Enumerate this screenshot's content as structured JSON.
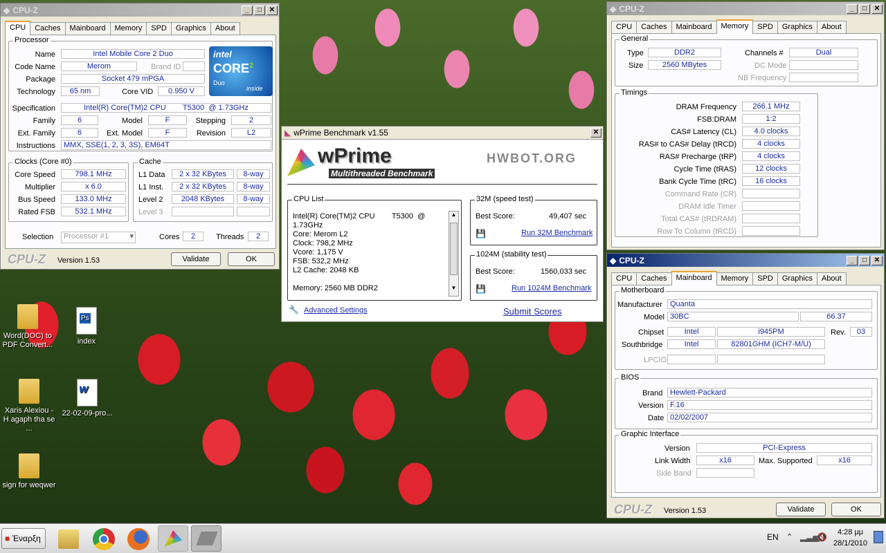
{
  "cpuz_cpu": {
    "title": "CPU-Z",
    "tabs": [
      "CPU",
      "Caches",
      "Mainboard",
      "Memory",
      "SPD",
      "Graphics",
      "About"
    ],
    "processor_label": "Processor",
    "name_label": "Name",
    "name": "Intel Mobile Core 2 Duo",
    "codename_label": "Code Name",
    "codename": "Merom",
    "brandid_label": "Brand ID",
    "package_label": "Package",
    "package": "Socket 479 mPGA",
    "technology_label": "Technology",
    "technology": "65 nm",
    "corevid_label": "Core VID",
    "corevid": "0.950 V",
    "spec_label": "Specification",
    "spec": "Intel(R) Core(TM)2 CPU        T5300  @ 1.73GHz",
    "family_label": "Family",
    "family": "6",
    "model_label": "Model",
    "model": "F",
    "stepping_label": "Stepping",
    "stepping": "2",
    "extfamily_label": "Ext. Family",
    "extfamily": "6",
    "extmodel_label": "Ext. Model",
    "extmodel": "F",
    "revision_label": "Revision",
    "revision": "L2",
    "instr_label": "Instructions",
    "instr": "MMX, SSE(1, 2, 3, 3S), EM64T",
    "clocks_label": "Clocks (Core #0)",
    "cache_label": "Cache",
    "corespeed_label": "Core Speed",
    "corespeed": "798.1 MHz",
    "multiplier_label": "Multiplier",
    "multiplier": "x 6.0",
    "busspeed_label": "Bus Speed",
    "busspeed": "133.0 MHz",
    "ratedfsb_label": "Rated FSB",
    "ratedfsb": "532.1 MHz",
    "l1d_label": "L1 Data",
    "l1d": "2 x 32 KBytes",
    "l1d_way": "8-way",
    "l1i_label": "L1 Inst.",
    "l1i": "2 x 32 KBytes",
    "l1i_way": "8-way",
    "l2_label": "Level 2",
    "l2": "2048 KBytes",
    "l2_way": "8-way",
    "l3_label": "Level 3",
    "selection_label": "Selection",
    "selection": "Processor #1",
    "cores_label": "Cores",
    "cores": "2",
    "threads_label": "Threads",
    "threads": "2",
    "version": "Version 1.53",
    "validate": "Validate",
    "ok": "OK",
    "logo_text": "CPU-Z",
    "intel_logo": {
      "brand": "intel",
      "core": "CORE",
      "sup": "2",
      "duo": "Duo",
      "inside": "inside"
    }
  },
  "cpuz_mem": {
    "title": "CPU-Z",
    "tabs": [
      "CPU",
      "Caches",
      "Mainboard",
      "Memory",
      "SPD",
      "Graphics",
      "About"
    ],
    "general_label": "General",
    "type_label": "Type",
    "type": "DDR2",
    "channels_label": "Channels #",
    "channels": "Dual",
    "size_label": "Size",
    "size": "2560 MBytes",
    "dcmode_label": "DC Mode",
    "nbfreq_label": "NB Frequency",
    "timings_label": "Timings",
    "rows": [
      {
        "l": "DRAM Frequency",
        "v": "266.1 MHz"
      },
      {
        "l": "FSB:DRAM",
        "v": "1:2"
      },
      {
        "l": "CAS# Latency (CL)",
        "v": "4.0 clocks"
      },
      {
        "l": "RAS# to CAS# Delay (tRCD)",
        "v": "4 clocks"
      },
      {
        "l": "RAS# Precharge (tRP)",
        "v": "4 clocks"
      },
      {
        "l": "Cycle Time (tRAS)",
        "v": "12 clocks"
      },
      {
        "l": "Bank Cycle Time (tRC)",
        "v": "16 clocks"
      }
    ],
    "dimrows": [
      "Command Rate (CR)",
      "DRAM Idle Timer",
      "Total CAS# (tRDRAM)",
      "Row To Column (tRCD)"
    ]
  },
  "cpuz_mb": {
    "title": "CPU-Z",
    "tabs": [
      "CPU",
      "Caches",
      "Mainboard",
      "Memory",
      "SPD",
      "Graphics",
      "About"
    ],
    "mb_label": "Motherboard",
    "manufacturer_label": "Manufacturer",
    "manufacturer": "Quanta",
    "model_label": "Model",
    "model": "30BC",
    "model2": "66.37",
    "chipset_label": "Chipset",
    "chipset": "Intel",
    "chipset2": "i945PM",
    "rev_label": "Rev.",
    "rev": "03",
    "sb_label": "Southbridge",
    "sb": "Intel",
    "sb2": "82801GHM (ICH7-M/U)",
    "lpcio_label": "LPCIO",
    "bios_label": "BIOS",
    "brand_label": "Brand",
    "brand": "Hewlett-Packard",
    "version_label": "Version",
    "version": "F.16",
    "date_label": "Date",
    "date": "02/02/2007",
    "gi_label": "Graphic Interface",
    "giversion_label": "Version",
    "giversion": "PCI-Express",
    "lw_label": "Link Width",
    "lw": "x16",
    "maxsup_label": "Max. Supported",
    "maxsup": "x16",
    "sideband_label": "Side Band",
    "version_footer": "Version 1.53",
    "validate": "Validate",
    "ok": "OK",
    "logo_text": "CPU-Z"
  },
  "wprime": {
    "title": "wPrime Benchmark v1.55",
    "logo": "wPrime",
    "subtitle": "Multithreaded Benchmark",
    "hwbot": "HWBOT.ORG",
    "cpulist_label": "CPU List",
    "cpu_lines": [
      "Intel(R) Core(TM)2 CPU        T5300  @",
      "1.73GHz",
      "Core: Merom L2",
      "Clock: 798,2 MHz",
      "Vcore: 1,175 V",
      "FSB: 532,2 MHz",
      "L2 Cache: 2048 KB",
      "",
      "Memory: 2560 MB DDR2"
    ],
    "m32_label": "32M (speed test)",
    "best_label": "Best Score:",
    "m32_score": "49,407 sec",
    "run32": "Run 32M Benchmark",
    "m1024_label": "1024M (stability test)",
    "m1024_score": "1560,033 sec",
    "run1024": "Run 1024M Benchmark",
    "adv": "Advanced Settings",
    "submit": "Submit Scores"
  },
  "desktop": {
    "icons": [
      {
        "label": "Word(DOC) to PDF Convert...",
        "type": "folder"
      },
      {
        "label": "index",
        "type": "ps"
      },
      {
        "label": "Xaris Alexiou - H agaph tha se ...",
        "type": "folder"
      },
      {
        "label": "22-02-09-pro...",
        "type": "doc"
      },
      {
        "label": "sign for weqwer",
        "type": "folder"
      }
    ]
  },
  "taskbar": {
    "start": "Έναρξη",
    "lang": "EN",
    "time": "4:28 μμ",
    "date": "28/1/2010"
  }
}
